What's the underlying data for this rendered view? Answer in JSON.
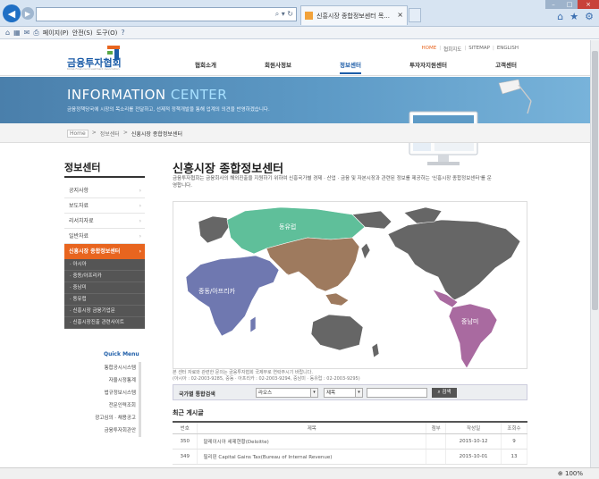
{
  "browser": {
    "tab_title": "신흥시장 종합정보센터 목...",
    "zoom_level": "100%",
    "command_bar": [
      "페이지(P)",
      "안전(S)",
      "도구(O)"
    ]
  },
  "header": {
    "logo_text": "금융투자협회",
    "logo_sub": "Korea Financial Investment Association",
    "utility_links": [
      "HOME",
      "협회지도",
      "SITEMAP",
      "ENGLISH"
    ],
    "gnb": [
      "협회소개",
      "회원사정보",
      "정보센터",
      "투자자지원센터",
      "고객센터"
    ],
    "gnb_active_index": 2
  },
  "hero": {
    "title_part1": "INFORMATION ",
    "title_part2": "CENTER",
    "subtitle": "금융정책당국에 시장의 목소리를 전달하고, 선제적 정책개발을 통해 업계의 의견을 반영하겠습니다."
  },
  "breadcrumb": [
    "Home",
    ">",
    "정보센터",
    ">",
    "신흥시장 종합정보센터"
  ],
  "lnb": {
    "title": "정보센터",
    "items": [
      {
        "label": "공지사항",
        "active": false
      },
      {
        "label": "보도자료",
        "active": false
      },
      {
        "label": "리서치자료",
        "active": false
      },
      {
        "label": "일반자료",
        "active": false
      },
      {
        "label": "신흥시장 종합정보센터",
        "active": true
      }
    ],
    "sub_items": [
      "· 아시아",
      "· 중동/아프리카",
      "· 중남미",
      "· 동유럽",
      "· 신흥시장 금융기업문",
      "· 신흥시장진출 관련사이트"
    ]
  },
  "quick_menu": {
    "title": "Quick Menu",
    "items": [
      "통합공시시스템",
      "자율시정통계",
      "법규정보시스템",
      "전문인력조회",
      "광고심의 · 채용공고",
      "금융투자회관안"
    ]
  },
  "content": {
    "title": "신흥시장 종합정보센터",
    "desc": "금융투자협회는 금융회사의 해외진출을 지원하기 위하여 신흥국가별 경제 · 산업 · 금융 및 자본시장과 관련된 정보를 제공하는 '신흥시장 종합정보센터'를 운영합니다.",
    "map_regions": [
      "동유럽",
      "아시아",
      "중동/아프리카",
      "중남미"
    ],
    "notice_line1": "본 센터 자료와 관련한 문의는 금융투자협회 국제부로 연락주시기 바랍니다.",
    "notice_line2": "(아시아 : 02-2003-9285, 중동 · 아프리카 : 02-2003-9294, 중남미 · 동유럽 : 02-2003-9295)"
  },
  "search": {
    "label": "국가별 통합검색",
    "select1": "라오스",
    "select2": "제목",
    "button": "검색"
  },
  "board": {
    "title": "최근 게시글",
    "headers": [
      "번호",
      "제목",
      "첨부",
      "작성일",
      "조회수"
    ],
    "rows": [
      {
        "no": "350",
        "title": "말레이시아 세제현황(Deloitte)",
        "attach": "",
        "date": "2015-10-12",
        "views": "9"
      },
      {
        "no": "349",
        "title": "필리핀 Capital Gains Tax(Bureau of Internal Revenue)",
        "attach": "",
        "date": "2015-10-01",
        "views": "13"
      }
    ]
  },
  "colors": {
    "brand_blue": "#1d5da8",
    "accent_orange": "#e8651f",
    "region_east_europe": "#5fbf9a",
    "region_asia": "#9e7a5e",
    "region_mideast_africa": "#6f78b0",
    "region_latam": "#a96aa0",
    "region_other": "#666666"
  }
}
